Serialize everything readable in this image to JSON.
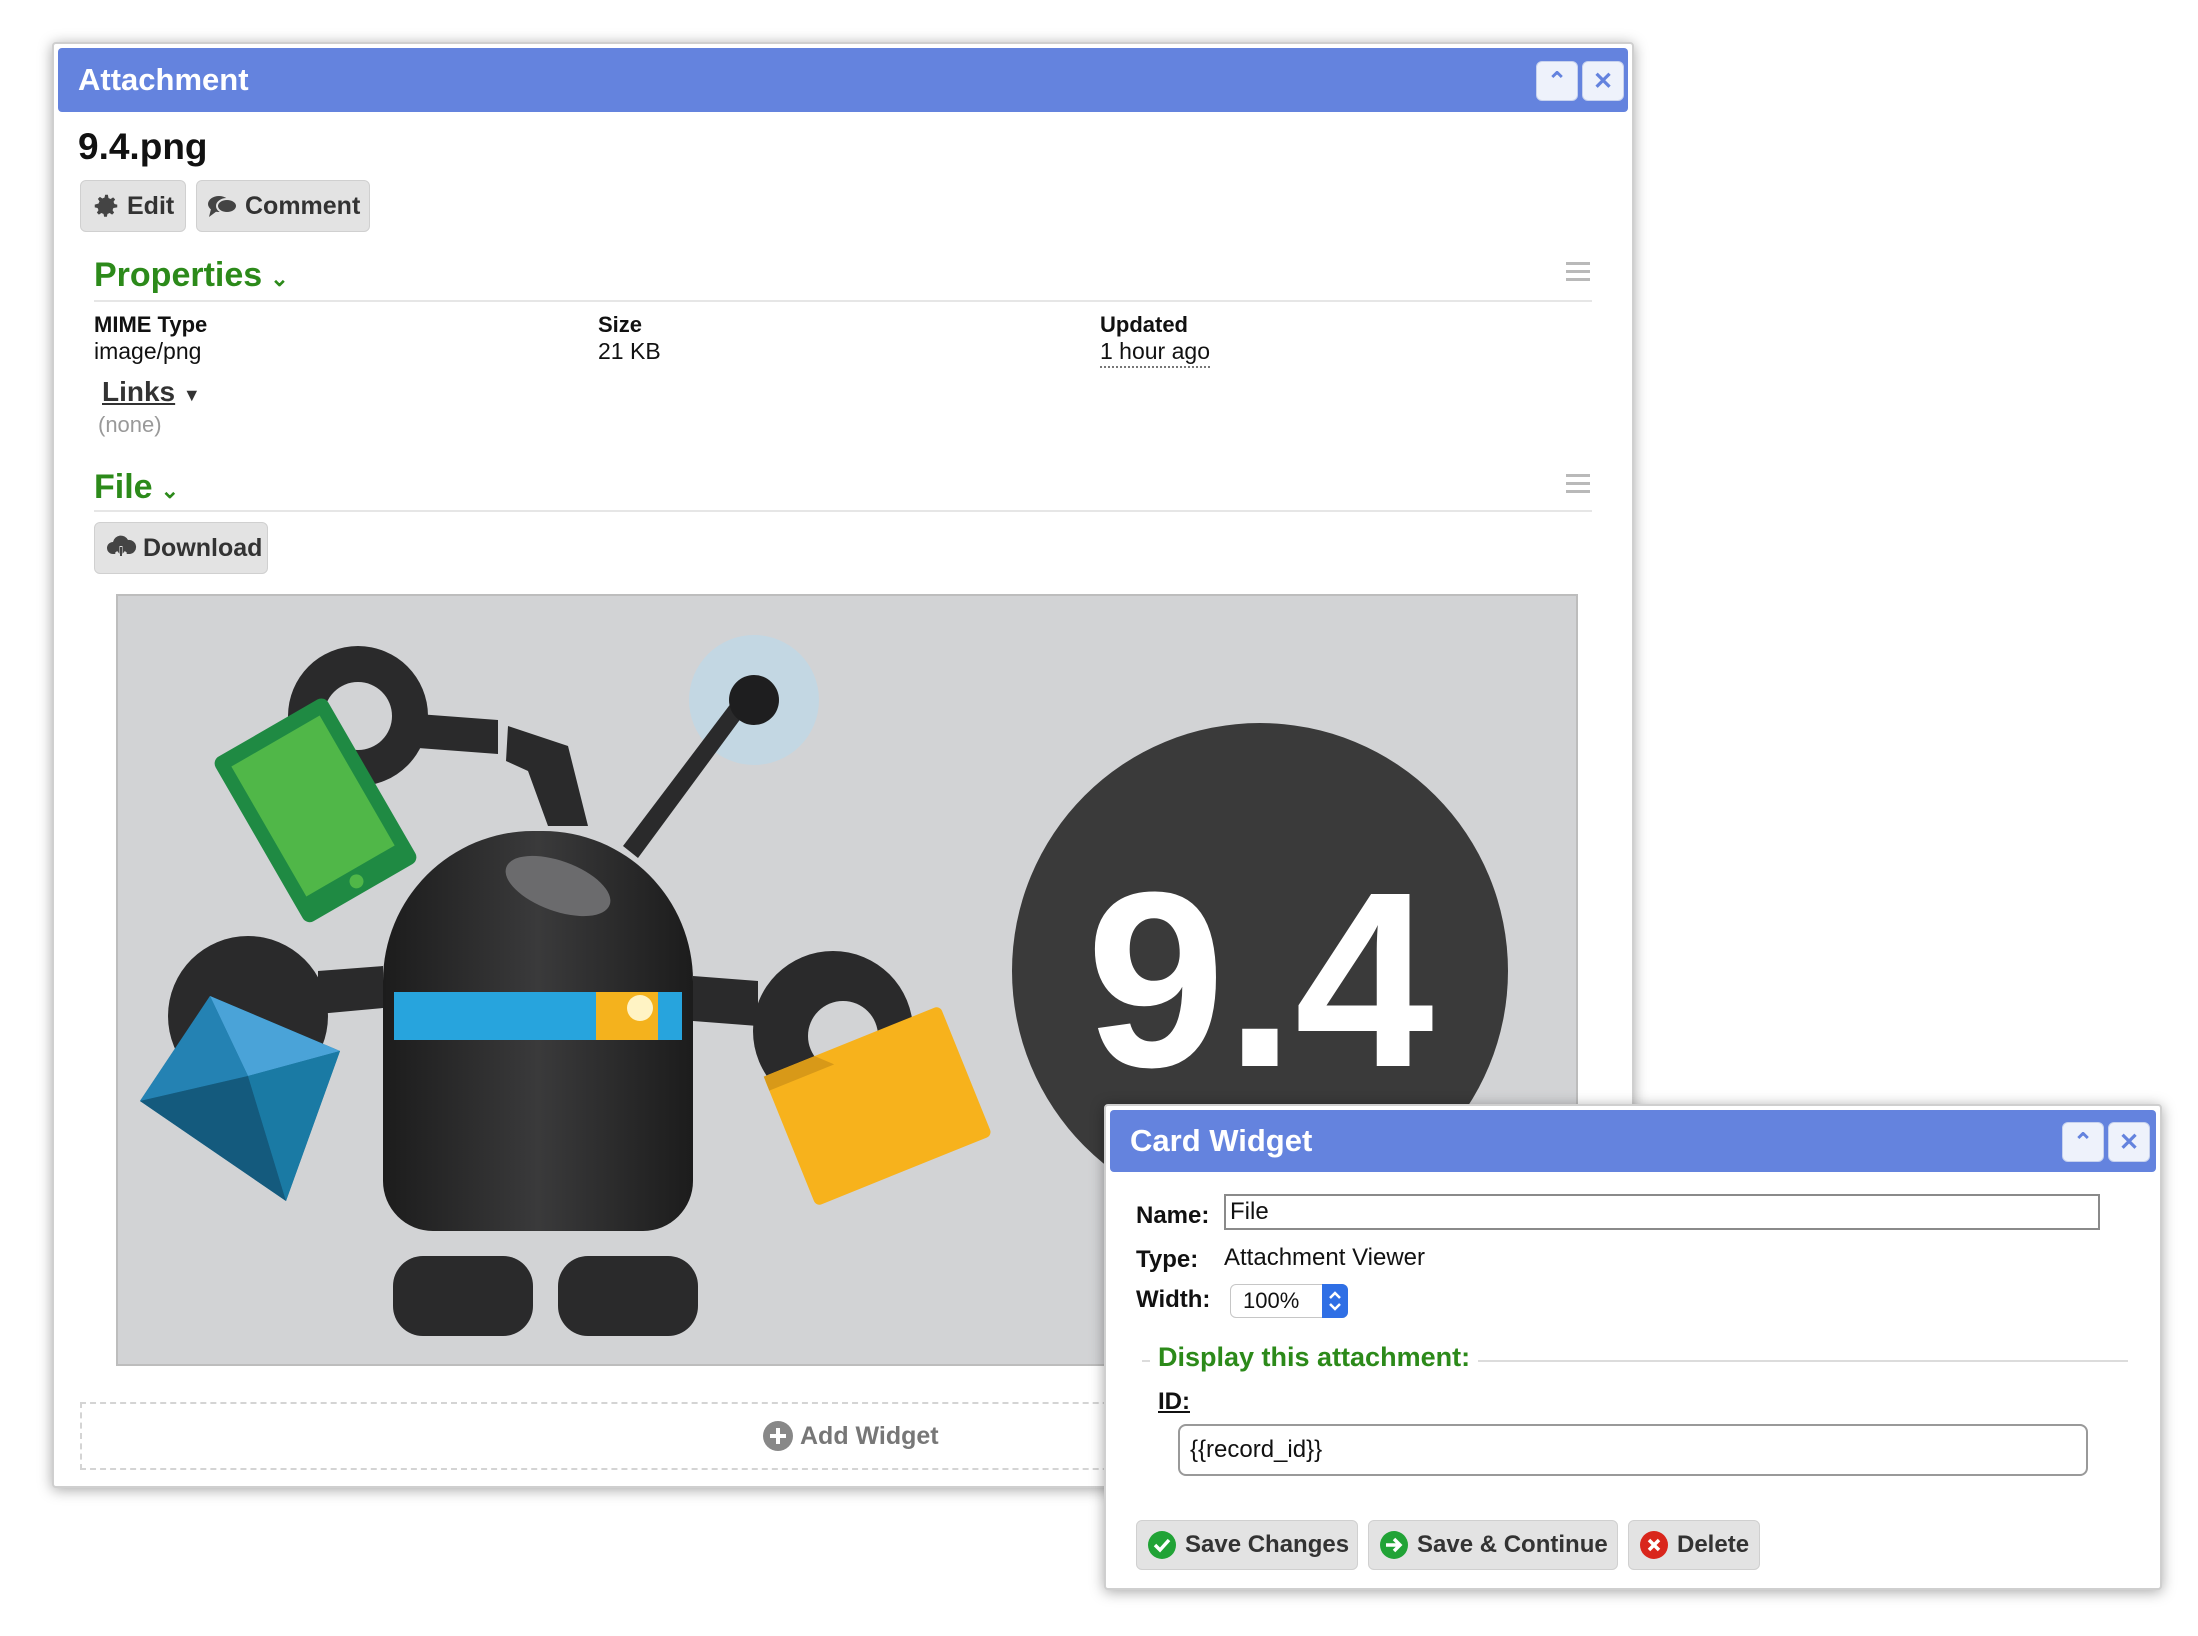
{
  "attachment_panel": {
    "title": "Attachment",
    "filename": "9.4.png",
    "buttons": {
      "edit": "Edit",
      "comment": "Comment",
      "download": "Download"
    },
    "properties": {
      "heading": "Properties",
      "mime_label": "MIME Type",
      "mime_value": "image/png",
      "size_label": "Size",
      "size_value": "21 KB",
      "updated_label": "Updated",
      "updated_value": "1 hour ago",
      "links_label": "Links",
      "links_value": "(none)"
    },
    "file_heading": "File",
    "image_text": "9.4",
    "add_widget": "Add Widget"
  },
  "card_widget": {
    "title": "Card Widget",
    "name_label": "Name:",
    "name_value": "File",
    "type_label": "Type:",
    "type_value": "Attachment Viewer",
    "width_label": "Width:",
    "width_value": "100%",
    "fieldset_legend": "Display this attachment:",
    "id_label": "ID:",
    "id_value": "{{record_id}}",
    "buttons": {
      "save": "Save Changes",
      "save_continue": "Save & Continue",
      "delete": "Delete"
    }
  },
  "colors": {
    "titlebar": "#6483de",
    "heading_green": "#2c8a1a",
    "button_bg": "#e3e3e3"
  },
  "icons": [
    "gear-icon",
    "comment-icon",
    "cloud-download-icon",
    "plus-circle-icon",
    "check-icon",
    "arrow-right-icon",
    "x-circle-icon",
    "collapse-icon",
    "close-icon",
    "menu-icon"
  ]
}
